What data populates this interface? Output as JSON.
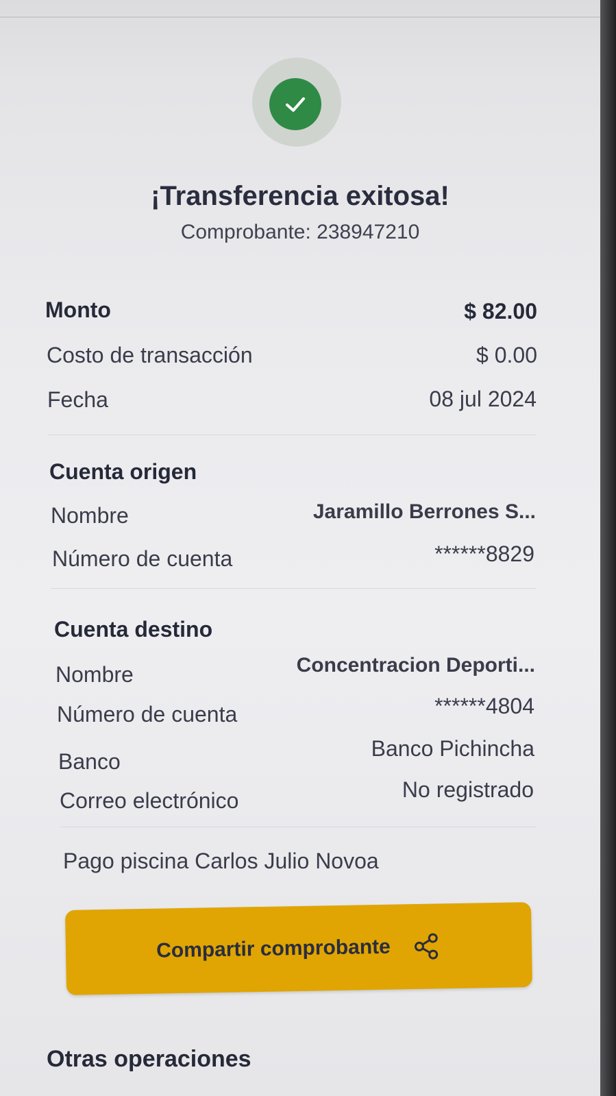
{
  "header": {
    "title": "¡Transferencia exitosa!",
    "receipt_label": "Comprobante: 238947210"
  },
  "summary": {
    "amount_label": "Monto",
    "amount_value": "$ 82.00",
    "cost_label": "Costo de transacción",
    "cost_value": "$ 0.00",
    "date_label": "Fecha",
    "date_value": "08 jul 2024"
  },
  "origin": {
    "title": "Cuenta origen",
    "name_label": "Nombre",
    "name_value": "Jaramillo  Berrones S...",
    "account_label": "Número de cuenta",
    "account_value": "******8829"
  },
  "destination": {
    "title": "Cuenta destino",
    "name_label": "Nombre",
    "name_value": "Concentracion Deporti...",
    "account_label": "Número de cuenta",
    "account_value": "******4804",
    "bank_label": "Banco",
    "bank_value": "Banco Pichincha",
    "email_label": "Correo electrónico",
    "email_value": "No registrado"
  },
  "note": "Pago piscina Carlos Julio Novoa",
  "actions": {
    "share_label": "Compartir comprobante",
    "share_icon": "share-icon"
  },
  "footer": {
    "other_ops": "Otras operaciones"
  },
  "colors": {
    "success": "#2f8a46",
    "accent": "#e0a502",
    "text": "#262938"
  }
}
